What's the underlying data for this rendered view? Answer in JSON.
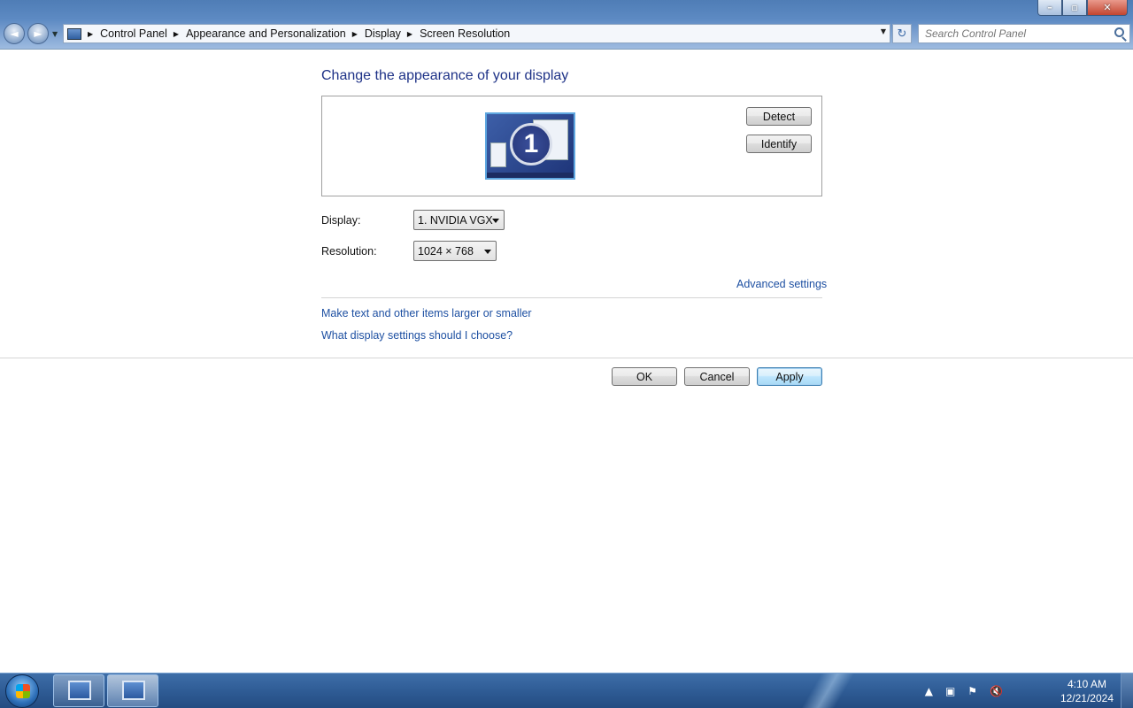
{
  "window": {
    "controls": {
      "minimize": "–",
      "maximize": "▫",
      "close": "✕"
    }
  },
  "nav": {
    "back_glyph": "◄",
    "forward_glyph": "►",
    "dropdown_glyph": "▼",
    "breadcrumbs": [
      "Control Panel",
      "Appearance and Personalization",
      "Display",
      "Screen Resolution"
    ],
    "separator": "▶",
    "refresh_glyph": "↻",
    "search_placeholder": "Search Control Panel"
  },
  "main": {
    "title": "Change the appearance of your display",
    "monitor_number": "1",
    "detect_label": "Detect",
    "identify_label": "Identify",
    "display_label": "Display:",
    "display_value": "1. NVIDIA VGX",
    "resolution_label": "Resolution:",
    "resolution_value": "1024 × 768",
    "advanced_link": "Advanced settings",
    "links": [
      "Make text and other items larger or smaller",
      "What display settings should I choose?"
    ],
    "ok_label": "OK",
    "cancel_label": "Cancel",
    "apply_label": "Apply"
  },
  "taskbar": {
    "tray_icons": [
      "show-hidden-icons",
      "network-icon",
      "action-center-flag-icon",
      "volume-muted-icon"
    ],
    "tray_glyphs": [
      "▲",
      "▣",
      "⚑",
      "🔇"
    ],
    "time": "4:10 AM",
    "date": "12/21/2024"
  },
  "colors": {
    "link": "#1e50a2",
    "title": "#1e3287",
    "taskbar": "#2f5c95"
  }
}
